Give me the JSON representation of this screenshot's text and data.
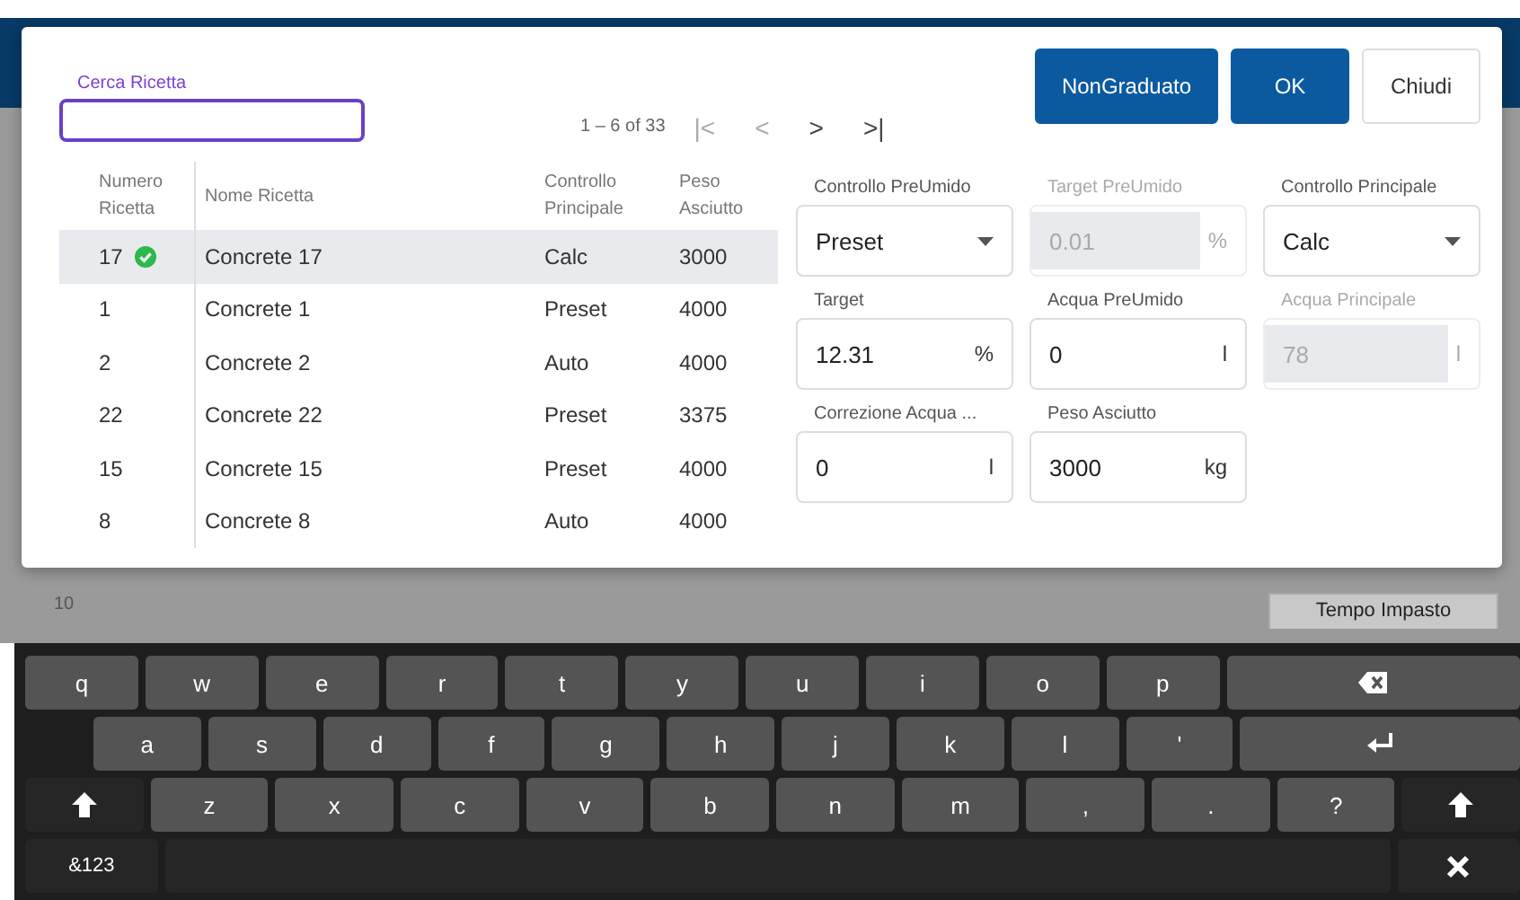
{
  "search": {
    "label": "Cerca Ricetta"
  },
  "pagination": {
    "range": "1 – 6 of 33",
    "first": "|<",
    "prev": "<",
    "next": ">",
    "last": ">|"
  },
  "buttons": [
    {
      "label": "NonGraduato",
      "kind": "primary"
    },
    {
      "label": "OK",
      "kind": "primary"
    },
    {
      "label": "Chiudi",
      "kind": "outline"
    }
  ],
  "table": {
    "columns": [
      "Numero Ricetta",
      "Nome Ricetta",
      "Controllo Principale",
      "Peso Asciutto"
    ],
    "rows": [
      {
        "cells": [
          "17",
          "Concrete 17",
          "Calc",
          "3000"
        ],
        "selected": true,
        "checked": true
      },
      {
        "cells": [
          "1",
          "Concrete 1",
          "Preset",
          "4000"
        ],
        "selected": false,
        "checked": false
      },
      {
        "cells": [
          "2",
          "Concrete 2",
          "Auto",
          "4000"
        ],
        "selected": false,
        "checked": false
      },
      {
        "cells": [
          "22",
          "Concrete 22",
          "Preset",
          "3375"
        ],
        "selected": false,
        "checked": false
      },
      {
        "cells": [
          "15",
          "Concrete 15",
          "Preset",
          "4000"
        ],
        "selected": false,
        "checked": false
      },
      {
        "cells": [
          "8",
          "Concrete 8",
          "Auto",
          "4000"
        ],
        "selected": false,
        "checked": false
      }
    ]
  },
  "fields": [
    {
      "label": "Controllo PreUmido",
      "value": "Preset",
      "kind": "select",
      "disabled": false
    },
    {
      "label": "Target PreUmido",
      "value": "0.01",
      "unit": "%",
      "kind": "input",
      "disabled": true
    },
    {
      "label": "Controllo Principale",
      "value": "Calc",
      "kind": "select",
      "disabled": false
    },
    {
      "label": "Target",
      "value": "12.31",
      "unit": "%",
      "kind": "input",
      "disabled": false
    },
    {
      "label": "Acqua PreUmido",
      "value": "0",
      "unit": "l",
      "kind": "input",
      "disabled": false
    },
    {
      "label": "Acqua Principale",
      "value": "78",
      "unit": "l",
      "kind": "input",
      "disabled": true
    },
    {
      "label": "Correzione Acqua ...",
      "value": "0",
      "unit": "l",
      "kind": "input",
      "disabled": false
    },
    {
      "label": "Peso Asciutto",
      "value": "3000",
      "unit": "kg",
      "kind": "input",
      "disabled": false
    }
  ],
  "background": {
    "axis_label": "10",
    "button": "Tempo Impasto"
  },
  "keyboard": {
    "rows": [
      [
        {
          "label": "q",
          "kind": "char"
        },
        {
          "label": "w",
          "kind": "char"
        },
        {
          "label": "e",
          "kind": "char"
        },
        {
          "label": "r",
          "kind": "char"
        },
        {
          "label": "t",
          "kind": "char"
        },
        {
          "label": "y",
          "kind": "char"
        },
        {
          "label": "u",
          "kind": "char"
        },
        {
          "label": "i",
          "kind": "char"
        },
        {
          "label": "o",
          "kind": "char"
        },
        {
          "label": "p",
          "kind": "char"
        },
        {
          "kind": "backspace"
        }
      ],
      [
        {
          "label": "a",
          "kind": "char"
        },
        {
          "label": "s",
          "kind": "char"
        },
        {
          "label": "d",
          "kind": "char"
        },
        {
          "label": "f",
          "kind": "char"
        },
        {
          "label": "g",
          "kind": "char"
        },
        {
          "label": "h",
          "kind": "char"
        },
        {
          "label": "j",
          "kind": "char"
        },
        {
          "label": "k",
          "kind": "char"
        },
        {
          "label": "l",
          "kind": "char"
        },
        {
          "label": "'",
          "kind": "char"
        },
        {
          "kind": "enter"
        }
      ],
      [
        {
          "kind": "shift"
        },
        {
          "label": "z",
          "kind": "char"
        },
        {
          "label": "x",
          "kind": "char"
        },
        {
          "label": "c",
          "kind": "char"
        },
        {
          "label": "v",
          "kind": "char"
        },
        {
          "label": "b",
          "kind": "char"
        },
        {
          "label": "n",
          "kind": "char"
        },
        {
          "label": "m",
          "kind": "char"
        },
        {
          "label": ",",
          "kind": "char"
        },
        {
          "label": ".",
          "kind": "char"
        },
        {
          "label": "?",
          "kind": "char"
        },
        {
          "kind": "shift"
        }
      ],
      [
        {
          "label": "&123",
          "kind": "mode"
        },
        {
          "kind": "space"
        },
        {
          "kind": "hide"
        }
      ]
    ]
  }
}
